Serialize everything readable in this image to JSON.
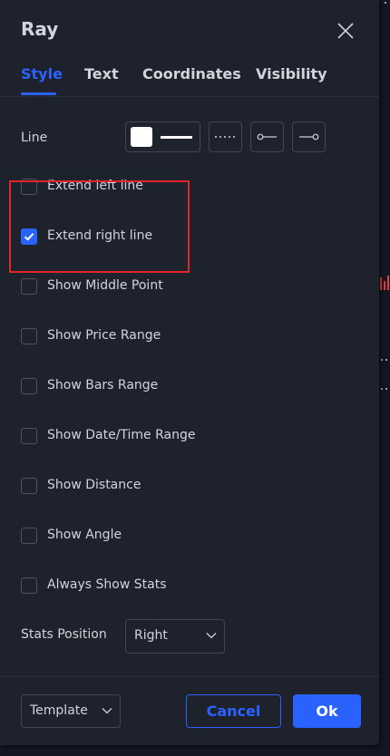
{
  "dialog": {
    "title": "Ray",
    "close_icon": "close-icon"
  },
  "tabs": [
    {
      "label": "Style",
      "active": true
    },
    {
      "label": "Text",
      "active": false
    },
    {
      "label": "Coordinates",
      "active": false
    },
    {
      "label": "Visibility",
      "active": false
    }
  ],
  "line": {
    "label": "Line",
    "color": "#ffffff",
    "style_options": [
      "solid-line-icon",
      "dotted-line-icon",
      "line-start-circle-icon",
      "line-end-circle-icon"
    ]
  },
  "checkboxes": [
    {
      "label": "Extend left line",
      "checked": false
    },
    {
      "label": "Extend right line",
      "checked": true
    },
    {
      "label": "Show Middle Point",
      "checked": false
    },
    {
      "label": "Show Price Range",
      "checked": false
    },
    {
      "label": "Show Bars Range",
      "checked": false
    },
    {
      "label": "Show Date/Time Range",
      "checked": false
    },
    {
      "label": "Show Distance",
      "checked": false
    },
    {
      "label": "Show Angle",
      "checked": false
    },
    {
      "label": "Always Show Stats",
      "checked": false
    }
  ],
  "stats_position": {
    "label": "Stats Position",
    "value": "Right"
  },
  "footer": {
    "template_label": "Template",
    "cancel_label": "Cancel",
    "ok_label": "Ok"
  },
  "colors": {
    "accent": "#2962ff",
    "background": "#1e222d",
    "highlight": "#e3242b"
  }
}
